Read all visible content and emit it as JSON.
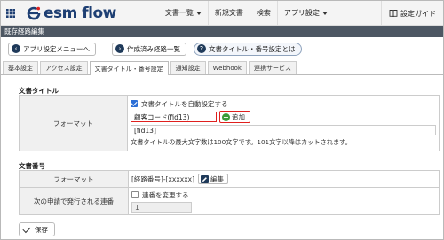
{
  "header": {
    "logo_text": "esm flow",
    "nav": [
      {
        "label": "文書一覧",
        "has_caret": true
      },
      {
        "label": "新規文書",
        "has_caret": false
      },
      {
        "label": "検索",
        "has_caret": false
      },
      {
        "label": "アプリ設定",
        "has_caret": true
      }
    ],
    "guide_label": "設定ガイド"
  },
  "page_title": "既存経路編集",
  "actions": {
    "back_label": "アプリ設定メニューへ",
    "list_label": "作成済み経路一覧",
    "help_label": "文書タイトル・番号設定とは"
  },
  "tabs": [
    {
      "label": "基本設定",
      "active": false
    },
    {
      "label": "アクセス設定",
      "active": false
    },
    {
      "label": "文書タイトル・番号設定",
      "active": true
    },
    {
      "label": "通知設定",
      "active": false
    },
    {
      "label": "Webhook",
      "active": false
    },
    {
      "label": "連携サービス",
      "active": false
    }
  ],
  "doc_title": {
    "section_label": "文書タイトル",
    "row_label": "フォーマット",
    "auto_setting_label": "文書タイトルを自動設定する",
    "auto_setting_checked": true,
    "field_select_value": "顧客コード(fid13)",
    "add_label": "追加",
    "format_value": "[fid13]",
    "note": "文書タイトルの最大文字数は100文字です。101文字以降はカットされます。"
  },
  "doc_number": {
    "section_label": "文書番号",
    "format_row_label": "フォーマット",
    "format_value": "[経路番号]-[xxxxxx]",
    "edit_label": "編集",
    "next_row_label": "次の申請で発行される連番",
    "change_label": "連番を変更する",
    "change_checked": false,
    "next_value": "1"
  },
  "save_label": "保存",
  "colors": {
    "title_bar": "#4d5763",
    "highlight": "#e0201e",
    "brand": "#1e3f73",
    "add_icon": "#3b9c3a"
  }
}
